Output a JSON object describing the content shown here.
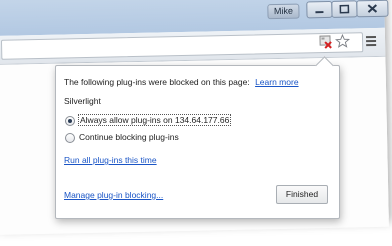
{
  "window": {
    "user_badge": "Mike"
  },
  "bubble": {
    "intro_text": "The following plug-ins were blocked on this page:",
    "learn_more": "Learn more",
    "plugin_name": "Silverlight",
    "options": [
      {
        "label": "Always allow plug-ins on 134.64.177.66",
        "selected": true
      },
      {
        "label": "Continue blocking plug-ins",
        "selected": false
      }
    ],
    "run_all": "Run all plug-ins this time",
    "manage": "Manage plug-in blocking...",
    "finished": "Finished"
  },
  "colors": {
    "link": "#1a55c6",
    "titlebar": "#b2c8e2"
  },
  "icons": [
    "blocked-plugin-icon",
    "star-icon",
    "menu-icon",
    "minimize-icon",
    "maximize-icon",
    "close-icon"
  ]
}
